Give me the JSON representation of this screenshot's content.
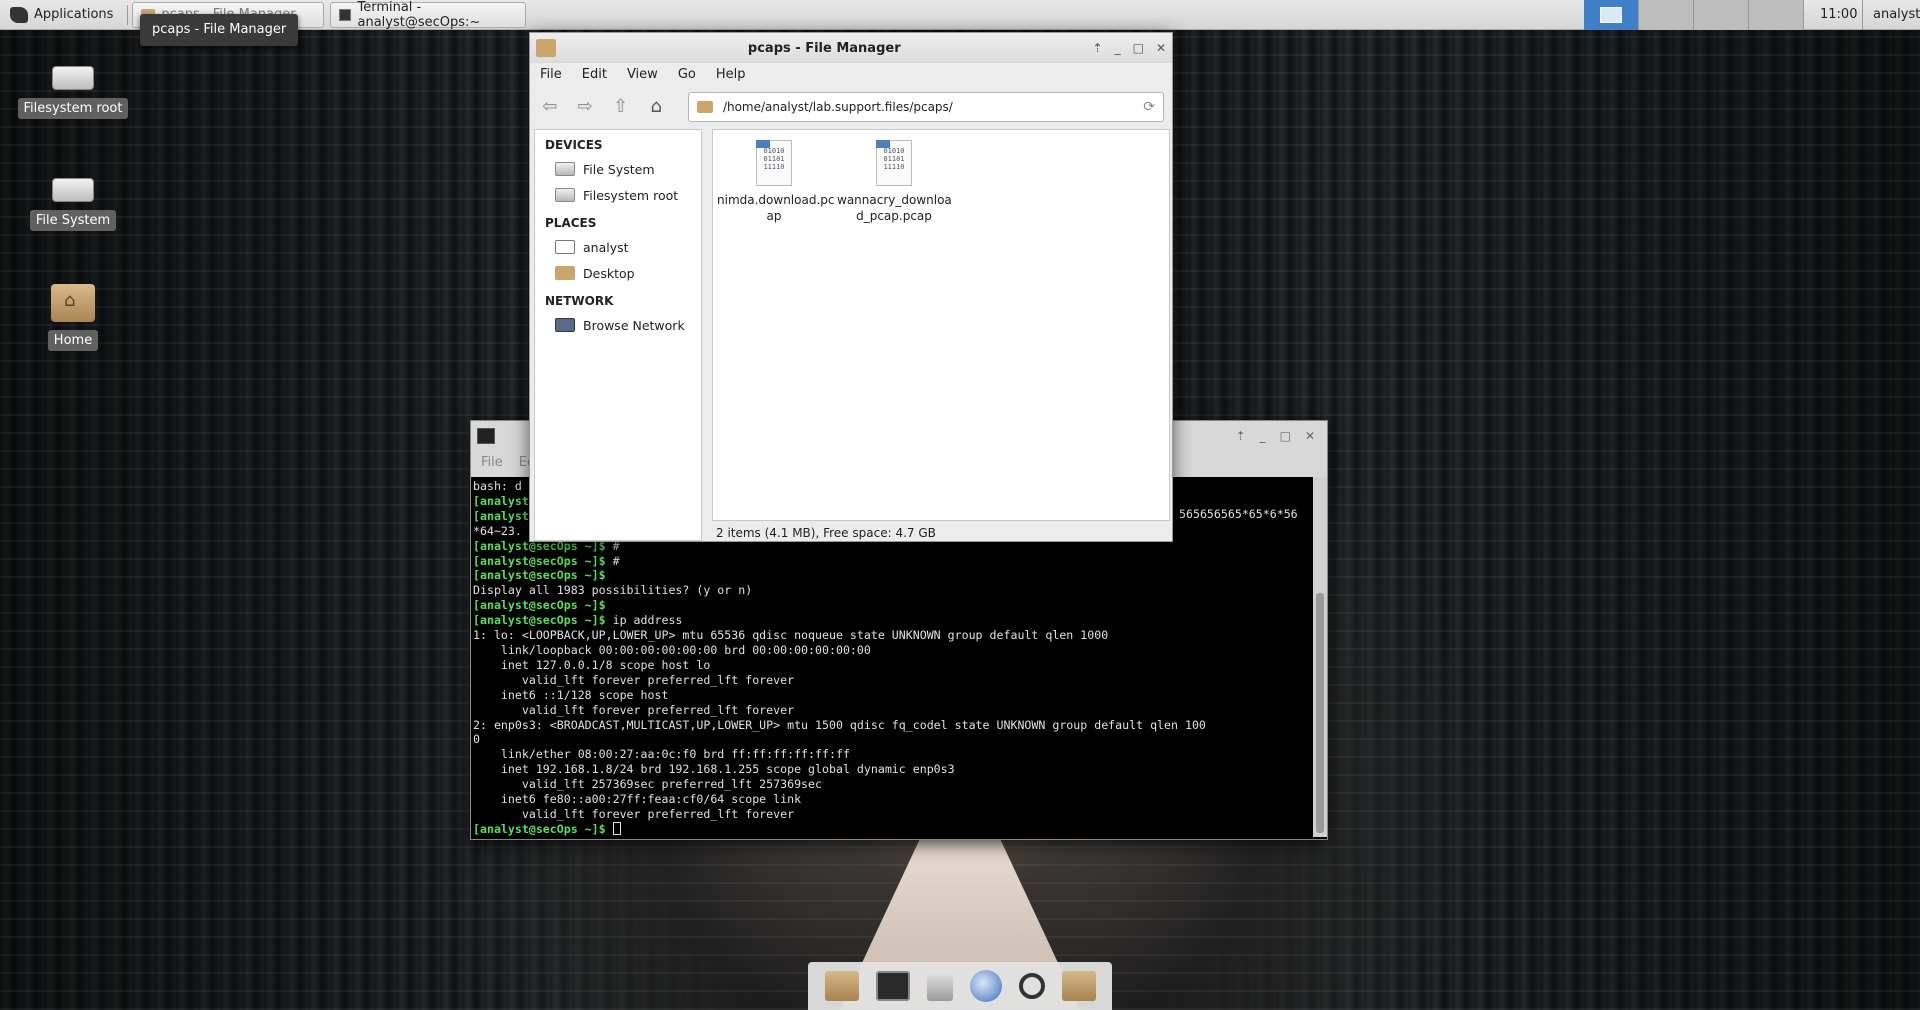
{
  "top_panel": {
    "applications_label": "Applications",
    "tasks": [
      {
        "label": "pcaps - File Manager"
      },
      {
        "label": "Terminal - analyst@secOps:~"
      }
    ],
    "clock": "11:00",
    "user": "analyst"
  },
  "tooltip": "pcaps - File Manager",
  "desktop_icons": [
    {
      "label": "Filesystem root"
    },
    {
      "label": "File System"
    },
    {
      "label": "Home"
    }
  ],
  "file_manager": {
    "title": "pcaps - File Manager",
    "menu": [
      "File",
      "Edit",
      "View",
      "Go",
      "Help"
    ],
    "path": "/home/analyst/lab.support.files/pcaps/",
    "sidebar": {
      "devices_heading": "DEVICES",
      "devices": [
        "File System",
        "Filesystem root"
      ],
      "places_heading": "PLACES",
      "places": [
        "analyst",
        "Desktop"
      ],
      "network_heading": "NETWORK",
      "network": [
        "Browse Network"
      ]
    },
    "files": [
      {
        "name_line1": "nimda.download.pc",
        "name_line2": "ap"
      },
      {
        "name_line1": "wannacry_downloa",
        "name_line2": "d_pcap.pcap"
      }
    ],
    "doc_glyph": "01010\n01101\n11110",
    "status": "2 items (4.1 MB), Free space: 4.7 GB"
  },
  "terminal": {
    "menu": [
      "File",
      "Ed"
    ],
    "lines": [
      {
        "prompt": "",
        "text": "bash: d"
      },
      {
        "prompt": "[analyst",
        "text": ""
      },
      {
        "prompt": "[analyst",
        "text": ""
      },
      {
        "prompt": "",
        "text": "*64~23."
      },
      {
        "prompt": "[analyst@secOps ~]$",
        "text": " #"
      },
      {
        "prompt": "[analyst@secOps ~]$",
        "text": " #"
      },
      {
        "prompt": "[analyst@secOps ~]$",
        "text": ""
      },
      {
        "prompt": "",
        "text": "Display all 1983 possibilities? (y or n)"
      },
      {
        "prompt": "[analyst@secOps ~]$",
        "text": ""
      },
      {
        "prompt": "[analyst@secOps ~]$",
        "text": " ip address"
      },
      {
        "prompt": "",
        "text": "1: lo: <LOOPBACK,UP,LOWER_UP> mtu 65536 qdisc noqueue state UNKNOWN group default qlen 1000"
      },
      {
        "prompt": "",
        "text": "    link/loopback 00:00:00:00:00:00 brd 00:00:00:00:00:00"
      },
      {
        "prompt": "",
        "text": "    inet 127.0.0.1/8 scope host lo"
      },
      {
        "prompt": "",
        "text": "       valid_lft forever preferred_lft forever"
      },
      {
        "prompt": "",
        "text": "    inet6 ::1/128 scope host"
      },
      {
        "prompt": "",
        "text": "       valid_lft forever preferred_lft forever"
      },
      {
        "prompt": "",
        "text": "2: enp0s3: <BROADCAST,MULTICAST,UP,LOWER_UP> mtu 1500 qdisc fq_codel state UNKNOWN group default qlen 100"
      },
      {
        "prompt": "",
        "text": "0"
      },
      {
        "prompt": "",
        "text": "    link/ether 08:00:27:aa:0c:f0 brd ff:ff:ff:ff:ff:ff"
      },
      {
        "prompt": "",
        "text": "    inet 192.168.1.8/24 brd 192.168.1.255 scope global dynamic enp0s3"
      },
      {
        "prompt": "",
        "text": "       valid_lft 257369sec preferred_lft 257369sec"
      },
      {
        "prompt": "",
        "text": "    inet6 fe80::a00:27ff:feaa:cf0/64 scope link"
      },
      {
        "prompt": "",
        "text": "       valid_lft forever preferred_lft forever"
      },
      {
        "prompt": "[analyst@secOps ~]$",
        "text": " "
      }
    ],
    "right_fragment_1": "565656565*65*6*56"
  },
  "colors": {
    "prompt": "#55e055",
    "pager_active": "#3f7fc7"
  }
}
